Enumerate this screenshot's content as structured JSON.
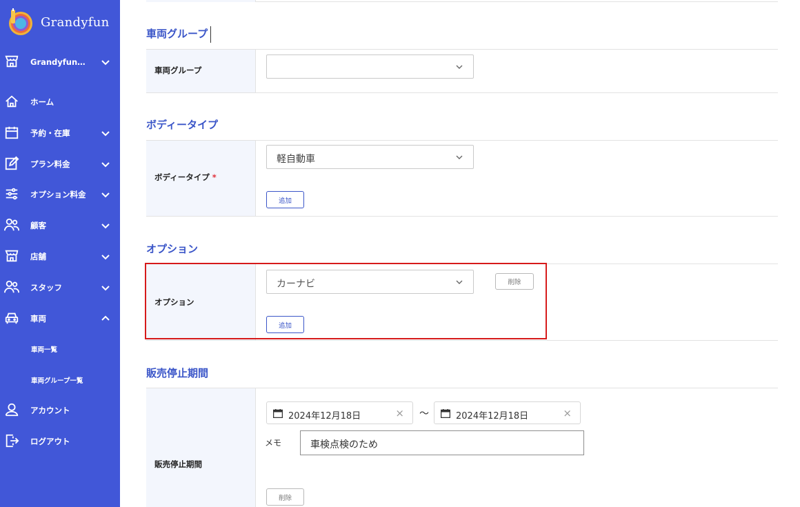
{
  "sidebar": {
    "logo_text": "Grandyfun",
    "org_selector": "Grandyfun…",
    "items": [
      {
        "label": "ホーム",
        "icon": "home-icon"
      },
      {
        "label": "予約・在庫",
        "icon": "calendar-icon"
      },
      {
        "label": "プラン料金",
        "icon": "edit-icon"
      },
      {
        "label": "オプション料金",
        "icon": "sliders-icon"
      },
      {
        "label": "顧客",
        "icon": "users-icon"
      },
      {
        "label": "店舗",
        "icon": "store-icon"
      },
      {
        "label": "スタッフ",
        "icon": "users-icon"
      },
      {
        "label": "車両",
        "icon": "car-icon"
      }
    ],
    "sub_items": [
      "車両一覧",
      "車両グループ一覧"
    ],
    "account": "アカウント",
    "logout": "ログアウト"
  },
  "sections": {
    "vehicle_group": {
      "title": "車両グループ",
      "label": "車両グループ",
      "value": ""
    },
    "body_type": {
      "title": "ボディータイプ",
      "label": "ボディータイプ",
      "required_mark": "*",
      "value": "軽自動車",
      "add_button": "追加"
    },
    "option": {
      "title": "オプション",
      "label": "オプション",
      "value": "カーナビ",
      "delete_button": "削除",
      "add_button": "追加"
    },
    "stop_period": {
      "title": "販売停止期間",
      "label": "販売停止期間",
      "start_date": "2024年12月18日",
      "end_date": "2024年12月18日",
      "separator": "～",
      "clear_symbol": "×",
      "memo_label": "メモ",
      "memo_value": "車検点検のため",
      "delete_button": "削除"
    }
  },
  "colors": {
    "sidebar_bg": "#4157d8",
    "accent": "#3a55c8",
    "label_bg": "#f3f6fd",
    "highlight": "#d61a1a",
    "required": "#e0303a"
  }
}
